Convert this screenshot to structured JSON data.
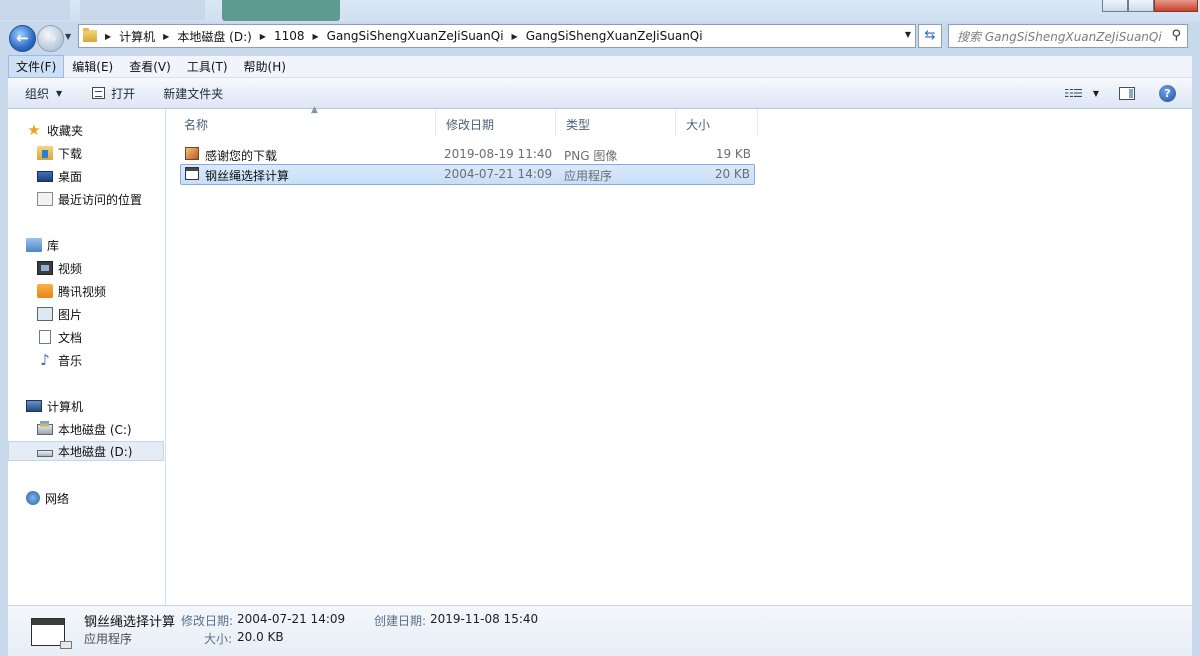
{
  "window": {
    "address": {
      "crumbs": [
        "计算机",
        "本地磁盘 (D:)",
        "1108",
        "GangSiShengXuanZeJiSuanQi",
        "GangSiShengXuanZeJiSuanQi"
      ]
    },
    "search": {
      "placeholder": "搜索 GangSiShengXuanZeJiSuanQi"
    },
    "icons": {
      "back": "back-arrow-icon",
      "forward": "forward-arrow-icon",
      "refresh": "refresh-icon",
      "search": "search-icon",
      "help": "help-icon"
    }
  },
  "menubar": {
    "items": [
      "文件(F)",
      "编辑(E)",
      "查看(V)",
      "工具(T)",
      "帮助(H)"
    ]
  },
  "toolbar": {
    "organize": "组织",
    "open": "打开",
    "new_folder": "新建文件夹"
  },
  "sidebar": {
    "favorites": {
      "label": "收藏夹",
      "items": [
        "下载",
        "桌面",
        "最近访问的位置"
      ]
    },
    "libraries": {
      "label": "库",
      "items": [
        "视频",
        "腾讯视频",
        "图片",
        "文档",
        "音乐"
      ]
    },
    "computer": {
      "label": "计算机",
      "items": [
        "本地磁盘 (C:)",
        "本地磁盘 (D:)"
      ]
    },
    "network": {
      "label": "网络"
    }
  },
  "columns": {
    "name": "名称",
    "date": "修改日期",
    "type": "类型",
    "size": "大小"
  },
  "files": [
    {
      "name": "感谢您的下载",
      "date": "2019-08-19 11:40",
      "type": "PNG 图像",
      "size": "19 KB"
    },
    {
      "name": "钢丝绳选择计算",
      "date": "2004-07-21 14:09",
      "type": "应用程序",
      "size": "20 KB"
    }
  ],
  "details": {
    "name": "钢丝绳选择计算",
    "type": "应用程序",
    "modified_label": "修改日期:",
    "modified": "2004-07-21 14:09",
    "size_label": "大小:",
    "size": "20.0 KB",
    "created_label": "创建日期:",
    "created": "2019-11-08 15:40"
  }
}
